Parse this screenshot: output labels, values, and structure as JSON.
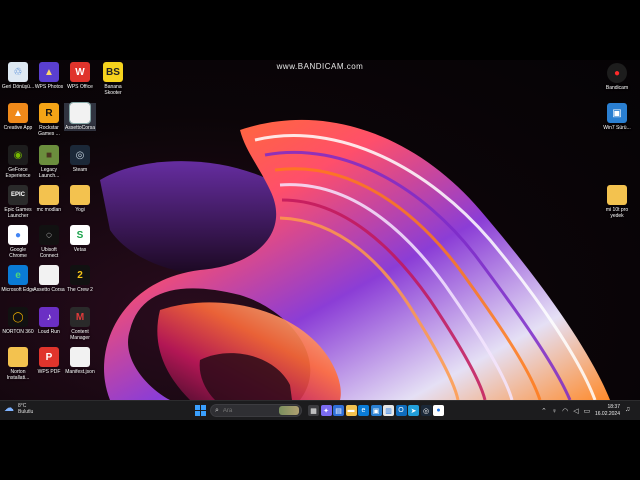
{
  "watermark": "www.BANDICAM.com",
  "desktop_icons_left": [
    {
      "label": "Geri Dönüşü...",
      "icon": "recycle-bin-icon",
      "bg": "#dfe9f3",
      "glyph": "♲",
      "fg": "#3a7bd5"
    },
    {
      "label": "WPS Photos",
      "icon": "wps-photos-icon",
      "bg": "#5a3fd0",
      "glyph": "▲",
      "fg": "#ffd86b"
    },
    {
      "label": "WPS Office",
      "icon": "wps-office-icon",
      "bg": "#e0342c",
      "glyph": "W",
      "fg": "#fff"
    },
    {
      "label": "Banana Skooter",
      "icon": "banana-skooter-icon",
      "bg": "#f6d31d",
      "glyph": "BS",
      "fg": "#222"
    },
    {
      "label": "Creative App",
      "icon": "creative-app-icon",
      "bg": "#f08a1a",
      "glyph": "▲",
      "fg": "#fff"
    },
    {
      "label": "Rockstar Games ...",
      "icon": "rockstar-games-icon",
      "bg": "#f4a416",
      "glyph": "R",
      "fg": "#111"
    },
    {
      "label": "AssettoCorsa",
      "icon": "assetto-corsa-file-icon",
      "bg": "#f2f2f2",
      "glyph": "",
      "fg": "#555"
    },
    {
      "label": "GeForce Experience",
      "icon": "geforce-icon",
      "bg": "#1d1d1d",
      "glyph": "◉",
      "fg": "#76b900"
    },
    {
      "label": "Legacy Launch...",
      "icon": "legacy-launcher-icon",
      "bg": "#6b8e3d",
      "glyph": "■",
      "fg": "#4b3620"
    },
    {
      "label": "Steam",
      "icon": "steam-icon",
      "bg": "#1b2838",
      "glyph": "◎",
      "fg": "#c7d5e0"
    },
    {
      "label": "Epic Games Launcher",
      "icon": "epic-games-icon",
      "bg": "#2a2a2a",
      "glyph": "EPIC",
      "fg": "#fff"
    },
    {
      "label": "mc modları",
      "icon": "folder-icon",
      "bg": "#f3c24f",
      "glyph": "",
      "fg": "#fff"
    },
    {
      "label": "Yogi",
      "icon": "folder-icon",
      "bg": "#f3c24f",
      "glyph": "",
      "fg": "#fff"
    },
    {
      "label": "Google Chrome",
      "icon": "chrome-icon",
      "bg": "#ffffff",
      "glyph": "●",
      "fg": "#4285f4"
    },
    {
      "label": "Ubisoft Connect",
      "icon": "ubisoft-icon",
      "bg": "#111",
      "glyph": "◌",
      "fg": "#fff"
    },
    {
      "label": "Vetas",
      "icon": "vetas-icon",
      "bg": "#ffffff",
      "glyph": "S",
      "fg": "#1aa24b"
    },
    {
      "label": "Microsoft Edge",
      "icon": "edge-icon",
      "bg": "#0a7bd6",
      "glyph": "e",
      "fg": "#4fd67a"
    },
    {
      "label": "Assetto Corsa",
      "icon": "assetto-corsa-icon",
      "bg": "#f2f2f2",
      "glyph": "",
      "fg": "#555"
    },
    {
      "label": "The Crew 2",
      "icon": "the-crew-2-icon",
      "bg": "#111",
      "glyph": "2",
      "fg": "#f5c518"
    },
    {
      "label": "NORTON 360",
      "icon": "norton-icon",
      "bg": "#111",
      "glyph": "◯",
      "fg": "#f5b400"
    },
    {
      "label": "Loud Run",
      "icon": "loud-run-icon",
      "bg": "#6b2fc4",
      "glyph": "♪",
      "fg": "#fff"
    },
    {
      "label": "Content Manager",
      "icon": "content-manager-icon",
      "bg": "#2a2a2a",
      "glyph": "M",
      "fg": "#e03a3a"
    },
    {
      "label": "Norton Installati...",
      "icon": "folder-icon",
      "bg": "#f3c24f",
      "glyph": "",
      "fg": "#fff"
    },
    {
      "label": "WPS PDF",
      "icon": "wps-pdf-icon",
      "bg": "#e0342c",
      "glyph": "P",
      "fg": "#fff"
    },
    {
      "label": "Manifest.json",
      "icon": "json-file-icon",
      "bg": "#f2f2f2",
      "glyph": "",
      "fg": "#555"
    }
  ],
  "desktop_icons_right": [
    {
      "label": "Bandicam",
      "icon": "bandicam-icon",
      "bg": "#1d1d1d",
      "glyph": "●",
      "fg": "#ff2a2a"
    },
    {
      "label": "Win7 Sürü...",
      "icon": "win7-driver-icon",
      "bg": "#2a7fd1",
      "glyph": "▣",
      "fg": "#fff"
    },
    {
      "label": "mi 10t pro yedek",
      "icon": "folder-icon",
      "bg": "#f3c24f",
      "glyph": "",
      "fg": "#fff"
    }
  ],
  "taskbar": {
    "weather_temp": "8°C",
    "weather_text": "Bulutlu",
    "search_placeholder": "Ara",
    "pinned": [
      {
        "icon": "task-view-icon",
        "bg": "#3c3c40",
        "glyph": "▦"
      },
      {
        "icon": "copilot-icon",
        "bg": "#7b6cf2",
        "glyph": "✦"
      },
      {
        "icon": "widgets-icon",
        "bg": "#2f6fd9",
        "glyph": "▤"
      },
      {
        "icon": "file-explorer-icon",
        "bg": "#f3c24f",
        "glyph": "▬"
      },
      {
        "icon": "edge-icon",
        "bg": "#0a7bd6",
        "glyph": "e"
      },
      {
        "icon": "store-icon",
        "bg": "#2a7fd1",
        "glyph": "▣"
      },
      {
        "icon": "calendar-icon",
        "bg": "#e6e6e6",
        "glyph": "▥"
      },
      {
        "icon": "outlook-icon",
        "bg": "#0f6cbd",
        "glyph": "O"
      },
      {
        "icon": "telegram-icon",
        "bg": "#229ed9",
        "glyph": "➤"
      },
      {
        "icon": "steam-icon",
        "bg": "#1b2838",
        "glyph": "◎"
      },
      {
        "icon": "chrome-icon",
        "bg": "#ffffff",
        "glyph": "●"
      }
    ],
    "time": "18:37",
    "date": "16.02.2024"
  }
}
